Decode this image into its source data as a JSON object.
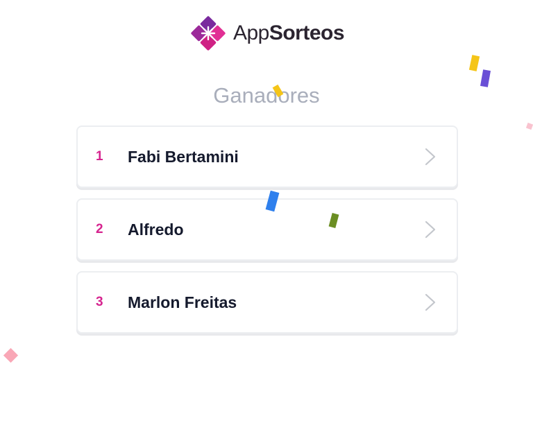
{
  "brand": {
    "name_light": "App",
    "name_bold": "Sorteos",
    "logo_icon": "sparkle-diamond-logo-icon",
    "colors": {
      "purple": "#7a2a9e",
      "magenta": "#d1248c",
      "pink": "#ee3aa0"
    }
  },
  "page": {
    "title": "Ganadores"
  },
  "winners": [
    {
      "rank": "1",
      "name": "Fabi Bertamini"
    },
    {
      "rank": "2",
      "name": "Alfredo"
    },
    {
      "rank": "3",
      "name": "Marlon Freitas"
    }
  ],
  "icons": {
    "row_arrow": "chevron-right-icon"
  },
  "theme": {
    "accent": "#d6248f",
    "text_primary": "#151a2d",
    "text_muted": "#a9aebb",
    "card_border": "#eceef1"
  },
  "confetti_colors": [
    "#f5c518",
    "#6a4fd6",
    "#f7b3c4",
    "#2f80ed",
    "#6b8e23",
    "#f9a7b6"
  ]
}
